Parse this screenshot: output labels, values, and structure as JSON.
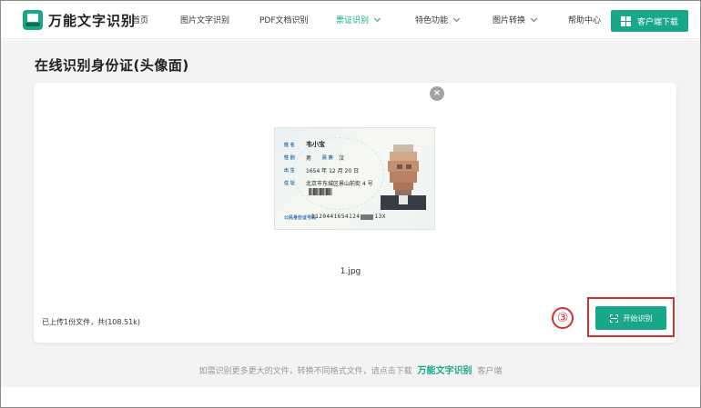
{
  "app": {
    "name": "万能文字识别"
  },
  "nav": {
    "items": [
      {
        "label": "首页",
        "has_dropdown": false,
        "active": false
      },
      {
        "label": "图片文字识别",
        "has_dropdown": false,
        "active": false
      },
      {
        "label": "PDF文档识别",
        "has_dropdown": false,
        "active": false
      },
      {
        "label": "票证识别",
        "has_dropdown": true,
        "active": true
      },
      {
        "label": "特色功能",
        "has_dropdown": true,
        "active": false
      },
      {
        "label": "图片转换",
        "has_dropdown": true,
        "active": false
      },
      {
        "label": "帮助中心",
        "has_dropdown": false,
        "active": false
      }
    ],
    "download_label": "客户端下载"
  },
  "page": {
    "title": "在线识别身份证(头像面)"
  },
  "id_card": {
    "labels": {
      "name": "姓 名",
      "gender": "性 别",
      "ethnicity": "民 族",
      "birth": "出 生",
      "address": "住 址",
      "id_number": "公民身份证号码"
    },
    "name": "韦小宝",
    "gender": "男",
    "ethnicity": "汉",
    "birth": "1654 年 12 月 20 日",
    "address": "北京市东城区景山前街 4 号",
    "id_number_prefix": "1120441654124",
    "id_number_suffix": "13X"
  },
  "upload": {
    "file_name": "1.jpg",
    "info": "已上传1份文件，共(108.51k)",
    "start_button": "开始识别",
    "step_marker": "③",
    "close": "×"
  },
  "footer": {
    "prefix": "如需识别更多更大的文件，转换不同格式文件，请点击下载",
    "brand": "万能文字识别",
    "suffix": "客户端"
  },
  "colors": {
    "accent": "#18a889",
    "highlight": "#d32f2f"
  }
}
